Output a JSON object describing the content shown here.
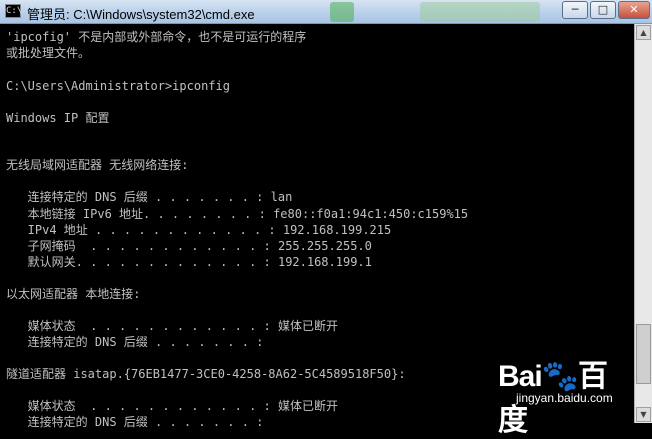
{
  "window": {
    "title": "管理员: C:\\Windows\\system32\\cmd.exe",
    "icon": "cmd-icon",
    "controls": {
      "minimize": "─",
      "maximize": "□",
      "close": "✕"
    }
  },
  "console": {
    "lines": [
      "'ipcofig' 不是内部或外部命令，也不是可运行的程序",
      "或批处理文件。",
      "",
      "C:\\Users\\Administrator>ipconfig",
      "",
      "Windows IP 配置",
      "",
      "",
      "无线局域网适配器 无线网络连接:",
      "",
      "   连接特定的 DNS 后缀 . . . . . . . : lan",
      "   本地链接 IPv6 地址. . . . . . . . : fe80::f0a1:94c1:450:c159%15",
      "   IPv4 地址 . . . . . . . . . . . . : 192.168.199.215",
      "   子网掩码  . . . . . . . . . . . . : 255.255.255.0",
      "   默认网关. . . . . . . . . . . . . : 192.168.199.1",
      "",
      "以太网适配器 本地连接:",
      "",
      "   媒体状态  . . . . . . . . . . . . : 媒体已断开",
      "   连接特定的 DNS 后缀 . . . . . . . :",
      "",
      "隧道适配器 isatap.{76EB1477-3CE0-4258-8A62-5C4589518F50}:",
      "",
      "   媒体状态  . . . . . . . . . . . . : 媒体已断开",
      "   连接特定的 DNS 后缀 . . . . . . . :"
    ]
  },
  "watermark": {
    "logo": "Bai🐾百度",
    "url": "jingyan.baidu.com"
  },
  "colors": {
    "console_bg": "#000000",
    "console_fg": "#c0c0c0",
    "titlebar": "#b9d0ea"
  }
}
